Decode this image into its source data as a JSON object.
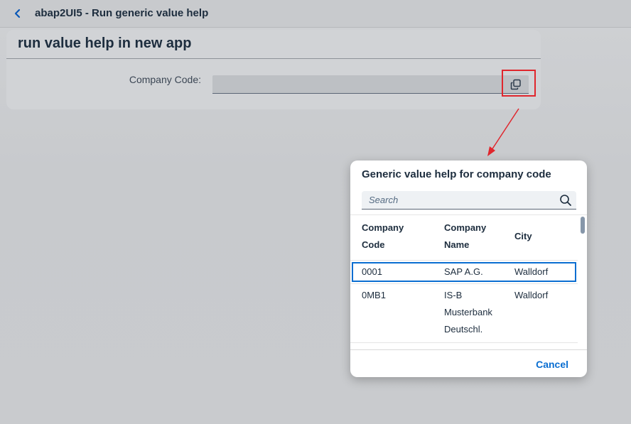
{
  "header": {
    "title": "abap2UI5 - Run generic value help",
    "back_icon": "chevron-left-icon"
  },
  "panel": {
    "title": "run value help in new app",
    "field_label": "Company Code:",
    "field_value": "",
    "value_help_icon": "value-help-icon"
  },
  "colors": {
    "accent": "#0a6ed1",
    "highlight": "#e0262d",
    "text": "#1d2d3e"
  },
  "dialog": {
    "title": "Generic value help for company code",
    "search_placeholder": "Search",
    "search_icon": "search-icon",
    "columns": {
      "code_line1": "Company",
      "code_line2": "Code",
      "name_line1": "Company",
      "name_line2": "Name",
      "city": "City"
    },
    "rows": [
      {
        "code": "0001",
        "name": "SAP A.G.",
        "city": "Walldorf"
      },
      {
        "code": "0MB1",
        "name_line1": "IS-B",
        "name_line2": "Musterbank",
        "name_line3": "Deutschl.",
        "city": "Walldorf"
      }
    ],
    "cancel_label": "Cancel"
  }
}
